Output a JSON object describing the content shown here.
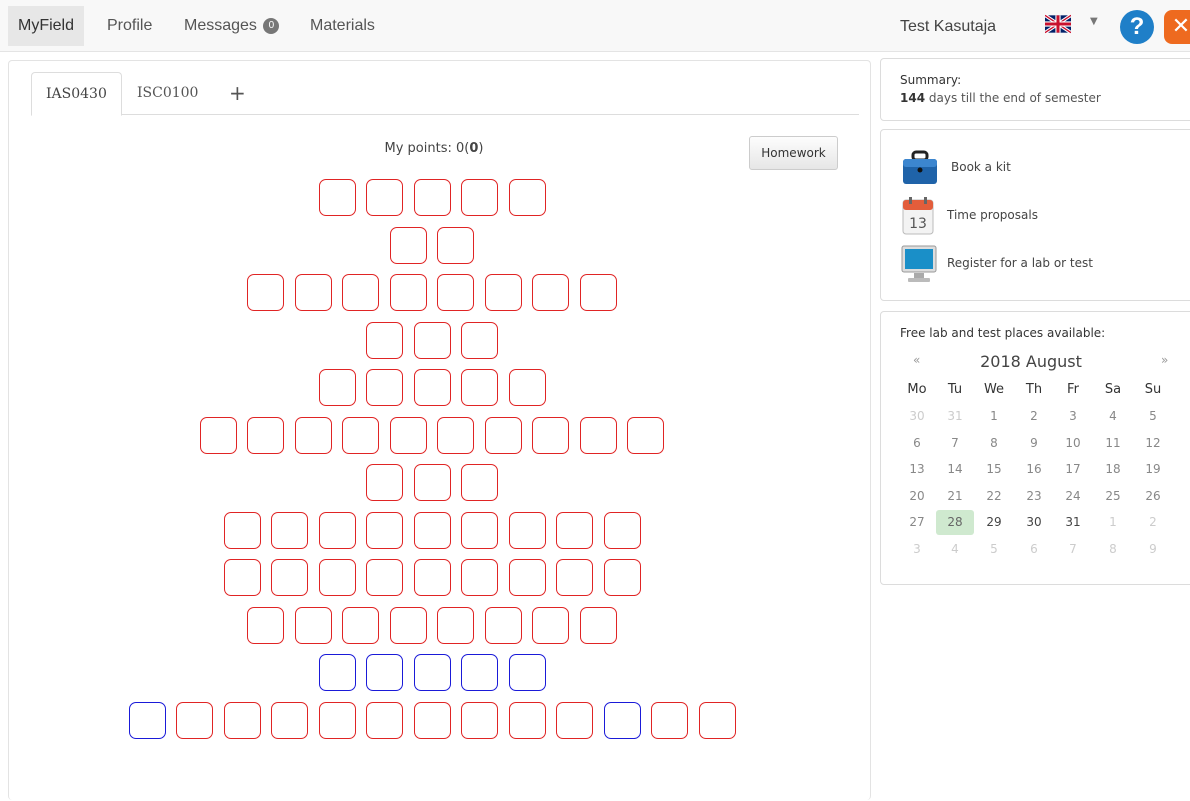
{
  "nav": {
    "items": [
      {
        "label": "MyField",
        "active": true
      },
      {
        "label": "Profile",
        "active": false
      },
      {
        "label": "Messages",
        "active": false,
        "badge": "0"
      },
      {
        "label": "Materials",
        "active": false
      }
    ],
    "user": "Test Kasutaja",
    "language_icon": "uk-flag-icon",
    "help_icon": "help-icon",
    "logout_icon": "logout-icon"
  },
  "tabs": [
    "IAS0430",
    "ISC0100",
    "+"
  ],
  "points": {
    "prefix": "My points: 0(",
    "bold": "0",
    "suffix": ")"
  },
  "homework_label": "Homework",
  "task_grid": {
    "legend_colors": {
      "red": "#e02424",
      "blue": "#1a1ad8"
    },
    "rows": [
      [
        "red",
        "red",
        "red",
        "red",
        "red"
      ],
      [
        "red",
        "red"
      ],
      [
        "red",
        "red",
        "red",
        "red",
        "red",
        "red",
        "red",
        "red"
      ],
      [
        "red",
        "red",
        "red"
      ],
      [
        "red",
        "red",
        "red",
        "red",
        "red"
      ],
      [
        "red",
        "red",
        "red",
        "red",
        "red",
        "red",
        "red",
        "red",
        "red",
        "red"
      ],
      [
        "red",
        "red",
        "red"
      ],
      [
        "red",
        "red",
        "red",
        "red",
        "red",
        "red",
        "red",
        "red",
        "red"
      ],
      [
        "red",
        "red",
        "red",
        "red",
        "red",
        "red",
        "red",
        "red",
        "red"
      ],
      [
        "red",
        "red",
        "red",
        "red",
        "red",
        "red",
        "red",
        "red"
      ],
      [
        "blue",
        "blue",
        "blue",
        "blue",
        "blue"
      ],
      [
        "blue",
        "red",
        "red",
        "red",
        "red",
        "red",
        "red",
        "red",
        "red",
        "red",
        "blue",
        "red",
        "red"
      ]
    ]
  },
  "summary": {
    "title": "Summary:",
    "days": "144",
    "days_text": " days till the end of semester"
  },
  "actions": [
    {
      "label": "Book a kit",
      "icon": "briefcase-icon"
    },
    {
      "label": "Time proposals",
      "icon": "calendar-icon"
    },
    {
      "label": "Register for a lab or test",
      "icon": "monitor-icon"
    }
  ],
  "calendar": {
    "title": "Free lab and test places available:",
    "prev": "«",
    "next": "»",
    "month": "2018 August",
    "weekdays": [
      "Mo",
      "Tu",
      "We",
      "Th",
      "Fr",
      "Sa",
      "Su"
    ],
    "weeks": [
      [
        {
          "d": "30",
          "t": "muted"
        },
        {
          "d": "31",
          "t": "muted"
        },
        {
          "d": "1",
          "t": "normal"
        },
        {
          "d": "2",
          "t": "normal"
        },
        {
          "d": "3",
          "t": "normal"
        },
        {
          "d": "4",
          "t": "normal"
        },
        {
          "d": "5",
          "t": "normal"
        }
      ],
      [
        {
          "d": "6",
          "t": "normal"
        },
        {
          "d": "7",
          "t": "normal"
        },
        {
          "d": "8",
          "t": "normal"
        },
        {
          "d": "9",
          "t": "normal"
        },
        {
          "d": "10",
          "t": "normal"
        },
        {
          "d": "11",
          "t": "normal"
        },
        {
          "d": "12",
          "t": "normal"
        }
      ],
      [
        {
          "d": "13",
          "t": "normal"
        },
        {
          "d": "14",
          "t": "normal"
        },
        {
          "d": "15",
          "t": "normal"
        },
        {
          "d": "16",
          "t": "normal"
        },
        {
          "d": "17",
          "t": "normal"
        },
        {
          "d": "18",
          "t": "normal"
        },
        {
          "d": "19",
          "t": "normal"
        }
      ],
      [
        {
          "d": "20",
          "t": "normal"
        },
        {
          "d": "21",
          "t": "normal"
        },
        {
          "d": "22",
          "t": "normal"
        },
        {
          "d": "23",
          "t": "normal"
        },
        {
          "d": "24",
          "t": "normal"
        },
        {
          "d": "25",
          "t": "normal"
        },
        {
          "d": "26",
          "t": "normal"
        }
      ],
      [
        {
          "d": "27",
          "t": "normal"
        },
        {
          "d": "28",
          "t": "today"
        },
        {
          "d": "29",
          "t": "current"
        },
        {
          "d": "30",
          "t": "current"
        },
        {
          "d": "31",
          "t": "current"
        },
        {
          "d": "1",
          "t": "muted"
        },
        {
          "d": "2",
          "t": "muted"
        }
      ],
      [
        {
          "d": "3",
          "t": "muted"
        },
        {
          "d": "4",
          "t": "muted"
        },
        {
          "d": "5",
          "t": "muted"
        },
        {
          "d": "6",
          "t": "muted"
        },
        {
          "d": "7",
          "t": "muted"
        },
        {
          "d": "8",
          "t": "muted"
        },
        {
          "d": "9",
          "t": "muted"
        }
      ]
    ]
  }
}
